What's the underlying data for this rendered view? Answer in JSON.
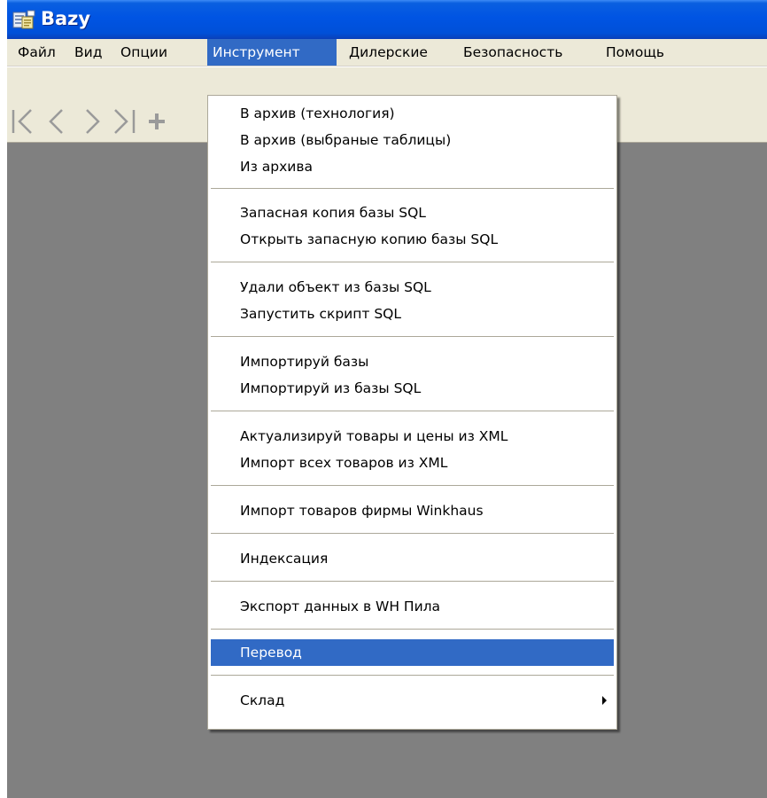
{
  "window": {
    "title": "Bazy",
    "icon": "app-icon"
  },
  "menubar": {
    "items": [
      {
        "label": "Файл"
      },
      {
        "label": "Вид"
      },
      {
        "label": "Опции"
      },
      {
        "label": "Инструмент",
        "open": true
      },
      {
        "label": "Дилерские"
      },
      {
        "label": "Безопасность"
      },
      {
        "label": "Помощь"
      }
    ]
  },
  "toolbar": {
    "buttons": [
      {
        "icon": "first-record-icon"
      },
      {
        "icon": "previous-record-icon"
      },
      {
        "icon": "next-record-icon"
      },
      {
        "icon": "last-record-icon"
      },
      {
        "icon": "add-record-icon"
      }
    ]
  },
  "dropdown": {
    "groups": [
      [
        "В архив (технология)",
        "В архив (выбраные таблицы)",
        "Из архива"
      ],
      [
        "Запасная копия базы SQL",
        "Открыть запасную копию базы SQL"
      ],
      [
        "Удали объект из базы SQL",
        "Запустить скрипт SQL"
      ],
      [
        "Импортируй базы",
        "Импортируй из базы SQL"
      ],
      [
        "Актуализируй товары и цены из XML",
        "Импорт всех товаров из XML"
      ],
      [
        "Импорт товаров фирмы Winkhaus"
      ],
      [
        "Индексация"
      ],
      [
        "Экспорт данных в WH Пила"
      ],
      [
        "Перевод"
      ],
      [
        "Склад"
      ]
    ],
    "selected": "Перевод",
    "submenu_item": "Склад"
  },
  "colors": {
    "titlebar": "#0054e3",
    "menubar": "#ece9d8",
    "highlight": "#316ac5",
    "workspace": "#808080"
  }
}
